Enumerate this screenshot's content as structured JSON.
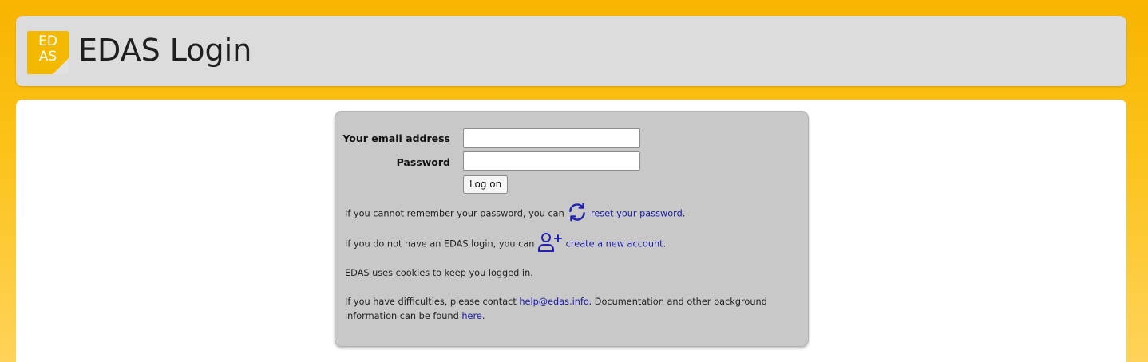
{
  "header": {
    "logo_text": "ED\nAS",
    "title": "EDAS Login"
  },
  "form": {
    "email_label": "Your email address",
    "email_value": "",
    "password_label": "Password",
    "password_value": "",
    "login_button": "Log on"
  },
  "help": {
    "reset_prefix": "If you cannot remember your password, you can",
    "reset_link": "reset your password",
    "reset_suffix": ".",
    "reset_icon": "refresh-icon",
    "account_prefix": "If you do not have an EDAS login, you can",
    "account_link": "create a new account",
    "account_suffix": ".",
    "account_icon": "add-user-icon",
    "cookies_text": "EDAS uses cookies to keep you logged in.",
    "contact_prefix": "If you have difficulties, please contact",
    "contact_email": "help@edas.info",
    "contact_middle": ". Documentation and other background",
    "contact_line2_prefix": "information can be found",
    "contact_here_link": "here",
    "contact_suffix": "."
  },
  "colors": {
    "accent": "#f8b400",
    "link": "#1a1aa6",
    "panel": "#c8c8c8"
  }
}
